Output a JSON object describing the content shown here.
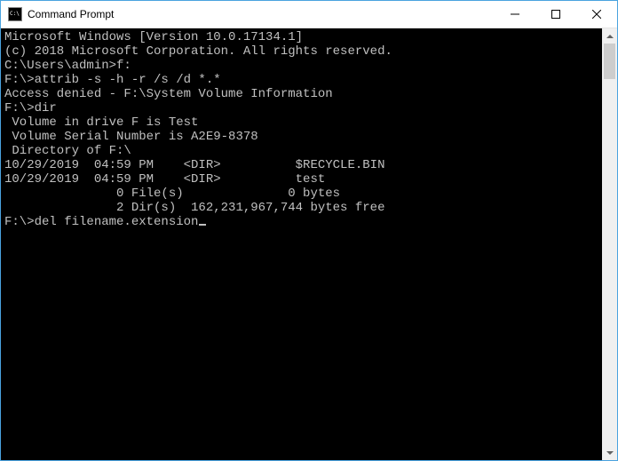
{
  "titlebar": {
    "title": "Command Prompt",
    "icon_name": "cmd-icon"
  },
  "console": {
    "lines": [
      "Microsoft Windows [Version 10.0.17134.1]",
      "(c) 2018 Microsoft Corporation. All rights reserved.",
      "",
      "C:\\Users\\admin>f:",
      "",
      "F:\\>attrib -s -h -r /s /d *.*",
      "Access denied - F:\\System Volume Information",
      "",
      "F:\\>dir",
      " Volume in drive F is Test",
      " Volume Serial Number is A2E9-8378",
      "",
      " Directory of F:\\",
      "",
      "10/29/2019  04:59 PM    <DIR>          $RECYCLE.BIN",
      "10/29/2019  04:59 PM    <DIR>          test",
      "               0 File(s)              0 bytes",
      "               2 Dir(s)  162,231,967,744 bytes free",
      "",
      "F:\\>del filename.extension"
    ],
    "cursor_after_last": true
  }
}
